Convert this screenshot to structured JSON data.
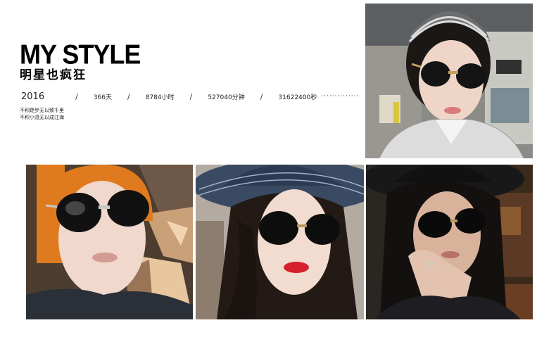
{
  "header": {
    "title": "MY STYLE",
    "subtitle": "明星也疯狂"
  },
  "stats": {
    "year": "2016",
    "days": "366天",
    "hours": "8784小时",
    "minutes": "527040分钟",
    "seconds": "31622400秒",
    "separator": "/",
    "dots": "··············"
  },
  "motto": {
    "line1": "不积跬步无以致千里",
    "line2": "不积小流无以成江海"
  },
  "photos": [
    {
      "name": "photo-woman-striped-headband",
      "icon": "clock-icon"
    },
    {
      "name": "photo-woman-orange-beanie"
    },
    {
      "name": "photo-woman-wide-brim-hat-red-lips"
    },
    {
      "name": "photo-woman-hat-hand-on-cheek"
    }
  ],
  "colors": {
    "text": "#111111",
    "background": "#ffffff",
    "lips": "#d6202b",
    "beanie": "#e07a1e"
  }
}
